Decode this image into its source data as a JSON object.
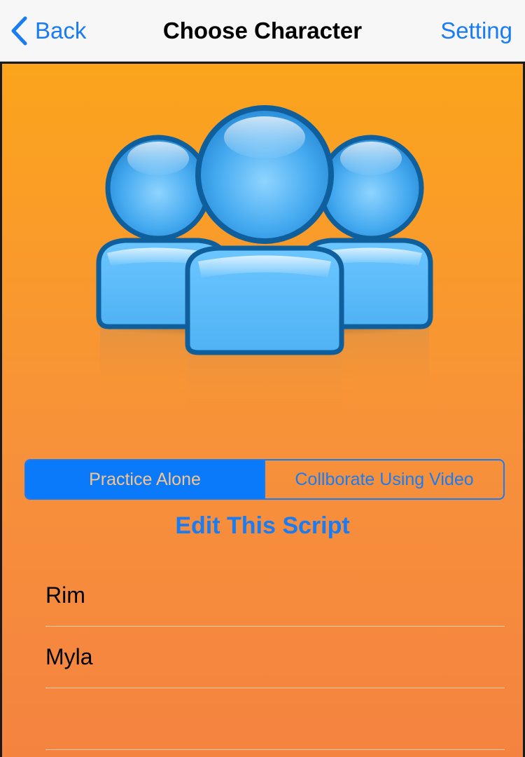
{
  "navbar": {
    "back_label": "Back",
    "title": "Choose Character",
    "setting_label": "Setting"
  },
  "colors": {
    "accent": "#1a7cf2",
    "gradient_top": "#fba41c",
    "gradient_bottom": "#f48340",
    "segment_selected_bg": "#0a7afa"
  },
  "hero": {
    "icon": "group-users-icon"
  },
  "segmented": {
    "options": [
      "Practice Alone",
      "Collborate Using Video"
    ],
    "selected": "Practice Alone"
  },
  "edit_script_label": "Edit This Script",
  "characters": [
    "Rim",
    "Myla",
    ""
  ]
}
